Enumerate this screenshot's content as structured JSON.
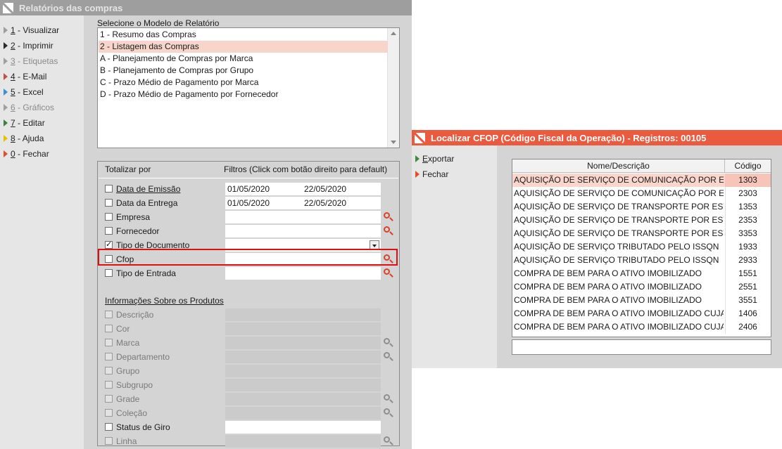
{
  "win1": {
    "title": "Relatórios das compras",
    "menu": [
      {
        "num": "1",
        "label": " - Visualizar",
        "disabled": false,
        "color": "#9e9e9e"
      },
      {
        "num": "2",
        "label": " - Imprimir",
        "disabled": false,
        "color": "#2c2c2c"
      },
      {
        "num": "3",
        "label": " - Etiquetas",
        "disabled": true,
        "color": "#a0a0a0"
      },
      {
        "num": "4",
        "label": " - E-Mail",
        "disabled": false,
        "color": "#c0504d"
      },
      {
        "num": "5",
        "label": " - Excel",
        "disabled": false,
        "color": "#3a8fd8"
      },
      {
        "num": "6",
        "label": " - Gráficos",
        "disabled": true,
        "color": "#a0a0a0"
      },
      {
        "num": "7",
        "label": " - Editar",
        "disabled": false,
        "color": "#3f7f3f"
      },
      {
        "num": "8",
        "label": " - Ajuda",
        "disabled": false,
        "color": "#e5c100"
      },
      {
        "num": "0",
        "label": " - Fechar",
        "disabled": false,
        "color": "#e0502a"
      }
    ],
    "model_label": "Selecione o Modelo de Relatório",
    "models": [
      "1 - Resumo das Compras",
      "2 - Listagem das Compras",
      "A - Planejamento de Compras por Marca",
      "B - Planejamento de Compras por Grupo",
      "C - Prazo Médio de Pagamento por Marca",
      "D - Prazo Médio de Pagamento por Fornecedor"
    ],
    "selected_model_index": 1,
    "panel": {
      "totalizar": "Totalizar por",
      "filtros": "Filtros (Click com botão direito para default)",
      "rows": [
        {
          "label": "Data de Emissão",
          "underline": true,
          "checked": false,
          "disabled": false,
          "from": "01/05/2020",
          "to": "22/05/2020",
          "lookup": false,
          "dropdown": false
        },
        {
          "label": "Data da Entrega",
          "underline": false,
          "checked": false,
          "disabled": false,
          "from": "01/05/2020",
          "to": "22/05/2020",
          "lookup": false,
          "dropdown": false
        },
        {
          "label": "Empresa",
          "underline": false,
          "checked": false,
          "disabled": false,
          "lookup": true,
          "dropdown": false
        },
        {
          "label": "Fornecedor",
          "underline": false,
          "checked": false,
          "disabled": false,
          "lookup": true,
          "dropdown": false
        },
        {
          "label": "Tipo de Documento",
          "underline": false,
          "checked": true,
          "disabled": false,
          "lookup": false,
          "dropdown": true
        },
        {
          "label": "Cfop",
          "underline": false,
          "checked": false,
          "disabled": false,
          "lookup": true,
          "dropdown": false
        },
        {
          "label": "Tipo de Entrada",
          "underline": false,
          "checked": false,
          "disabled": false,
          "lookup": true,
          "dropdown": false
        }
      ],
      "products_header": "Informações Sobre os Produtos",
      "product_rows": [
        {
          "label": "Descrição",
          "checked": false,
          "disabled": true,
          "lookup": false,
          "box": "disabled"
        },
        {
          "label": "Cor",
          "checked": false,
          "disabled": true,
          "lookup": false,
          "box": "disabled"
        },
        {
          "label": "Marca",
          "checked": false,
          "disabled": true,
          "lookup": true,
          "box": "disabled"
        },
        {
          "label": "Departamento",
          "checked": false,
          "disabled": true,
          "lookup": true,
          "box": "disabled"
        },
        {
          "label": "Grupo",
          "checked": false,
          "disabled": true,
          "lookup": false,
          "box": "disabled"
        },
        {
          "label": "Subgrupo",
          "checked": false,
          "disabled": true,
          "lookup": false,
          "box": "disabled"
        },
        {
          "label": "Grade",
          "checked": false,
          "disabled": true,
          "lookup": true,
          "box": "disabled"
        },
        {
          "label": "Coleção",
          "checked": false,
          "disabled": true,
          "lookup": true,
          "box": "disabled"
        },
        {
          "label": "Status de Giro",
          "checked": false,
          "disabled": false,
          "lookup": false,
          "box": "white"
        },
        {
          "label": "Linha",
          "checked": false,
          "disabled": true,
          "lookup": true,
          "box": "disabled"
        }
      ]
    }
  },
  "win2": {
    "title": "Localizar CFOP (Código Fiscal da Operação) - Registros: 00105",
    "menu": [
      {
        "accel": "E",
        "rest": "xportar",
        "color": "#3f8a3f"
      },
      {
        "accel": "",
        "rest": "Fechar",
        "color": "#e0502a"
      }
    ],
    "columns": [
      "Nome/Descrição",
      "Código"
    ],
    "rows": [
      [
        "AQUISIÇÃO DE SERVIÇO DE COMUNICAÇÃO POR ESTABE",
        "1303"
      ],
      [
        "AQUISIÇÃO DE SERVIÇO DE COMUNICAÇÃO POR ESTABE",
        "2303"
      ],
      [
        "AQUISIÇÃO DE SERVIÇO DE TRANSPORTE POR ESTABEL",
        "1353"
      ],
      [
        "AQUISIÇÃO DE SERVIÇO DE TRANSPORTE POR ESTABEL",
        "2353"
      ],
      [
        "AQUISIÇÃO DE SERVIÇO DE TRANSPORTE POR ESTABEL",
        "3353"
      ],
      [
        "AQUISIÇÃO DE SERVIÇO TRIBUTADO PELO ISSQN",
        "1933"
      ],
      [
        "AQUISIÇÃO DE SERVIÇO TRIBUTADO PELO ISSQN",
        "2933"
      ],
      [
        "COMPRA DE BEM PARA O ATIVO IMOBILIZADO",
        "1551"
      ],
      [
        "COMPRA DE BEM PARA O ATIVO IMOBILIZADO",
        "2551"
      ],
      [
        "COMPRA DE BEM PARA O ATIVO IMOBILIZADO",
        "3551"
      ],
      [
        "COMPRA DE BEM PARA O ATIVO IMOBILIZADO CUJA MER",
        "1406"
      ],
      [
        "COMPRA DE BEM PARA O ATIVO IMOBILIZADO CUJA MER",
        "2406"
      ]
    ],
    "selected_row_index": 0,
    "search_value": ""
  },
  "colors": {
    "accent_red": "#ea5a3f",
    "highlight_red": "#e01010",
    "selection": "#f8d5cb"
  }
}
